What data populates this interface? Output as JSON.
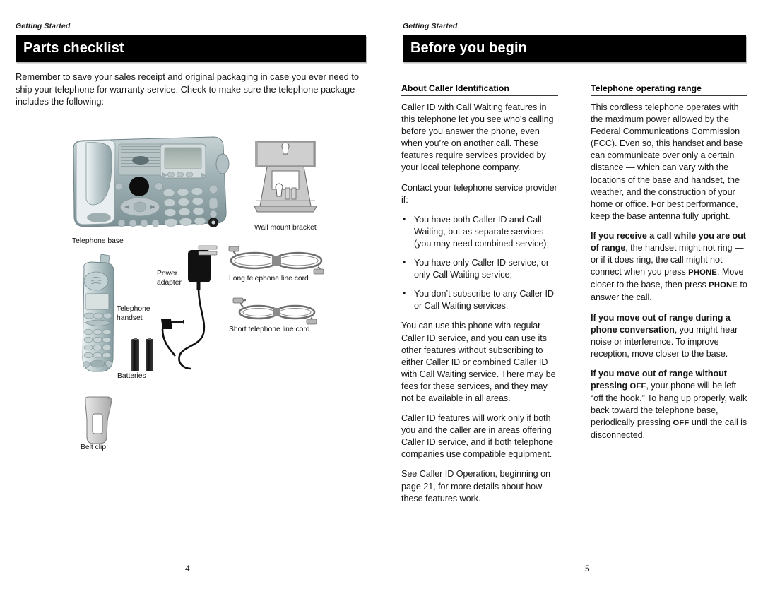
{
  "document": {
    "left_page": {
      "running_head": "Getting Started",
      "title": "Parts checklist",
      "page_number": "4",
      "intro": "Remember to save your sales receipt and original packaging in case you ever need to ship your telephone for warranty service. Check to make sure the telephone package includes the following:",
      "parts": [
        {
          "id": "telephone-base",
          "caption": "Telephone base"
        },
        {
          "id": "wall-mount-bracket",
          "caption": "Wall mount bracket"
        },
        {
          "id": "telephone-handset",
          "caption": "Telephone\nhandset"
        },
        {
          "id": "power-adapter",
          "caption": "Power\nadapter"
        },
        {
          "id": "long-line-cord",
          "caption": "Long telephone line cord"
        },
        {
          "id": "short-line-cord",
          "caption": "Short telephone line cord"
        },
        {
          "id": "batteries",
          "caption": "Batteries"
        },
        {
          "id": "belt-clip",
          "caption": "Belt clip"
        }
      ]
    },
    "right_page": {
      "running_head": "Getting Started",
      "title": "Before you begin",
      "page_number": "5",
      "column_left": {
        "heading": "About Caller Identification",
        "para_1": "Caller ID with Call Waiting features in this telephone let you see who’s calling before you answer the phone, even when you’re on another call. These features require services provided by your local telephone company.",
        "para_2": "Contact your telephone service provider if:",
        "bullets": [
          "You have both Caller ID and Call Waiting, but as separate services (you may need combined service);",
          "You have only Caller ID service, or only Call Waiting service;",
          "You don’t subscribe to any Caller ID or Call Waiting services."
        ],
        "para_3": "You can use this phone with regular Caller ID service, and you can use its other features without subscribing to either Caller ID or combined Caller ID with Call Waiting service. There may be fees for these services, and they may not be available in all areas.",
        "para_4": "Caller ID features will work only if both you and the caller are in areas offering Caller ID service, and if both telephone companies use compatible equipment.",
        "para_5": "See Caller ID Operation, beginning on page 21, for more details about how these features work."
      },
      "column_right": {
        "heading": "Telephone operating range",
        "para_1": "This cordless telephone operates with the maximum power allowed by the Federal Communications Commission (FCC). Even so, this handset and base can communicate over only a certain distance — which can vary with the locations of the base and handset, the weather, and the construction of your home or office. For best performance, keep the base antenna fully upright.",
        "para_2_bold": "If you receive a call while you are out of range",
        "para_2_a": ", the handset might not ring — or if it does ring, the call might not connect when you press ",
        "para_2_key1": "PHONE",
        "para_2_b": ". Move closer to the base, then press ",
        "para_2_key2": "PHONE",
        "para_2_c": " to answer the call.",
        "para_3_bold": "If you move out of range during a phone conversation",
        "para_3_a": ", you might hear noise or interference. To improve reception, move closer to the base.",
        "para_4_bold_a": "If you move out of range without pressing ",
        "para_4_key1": "OFF",
        "para_4_a": ", your phone will be left “off the hook.” To hang up properly, walk back toward the telephone base, periodically pressing ",
        "para_4_key2": "OFF",
        "para_4_b": " until the call is disconnected."
      }
    }
  },
  "colors": {
    "title_bar": "#000000",
    "title_text": "#ffffff",
    "body_text": "#161616",
    "page_background": "#ffffff",
    "device_teal": "#8fa8ac",
    "device_silver": "#c9d3d6",
    "cord_grey": "#6a6a6a",
    "bracket_grey": "#bdbdbd"
  }
}
